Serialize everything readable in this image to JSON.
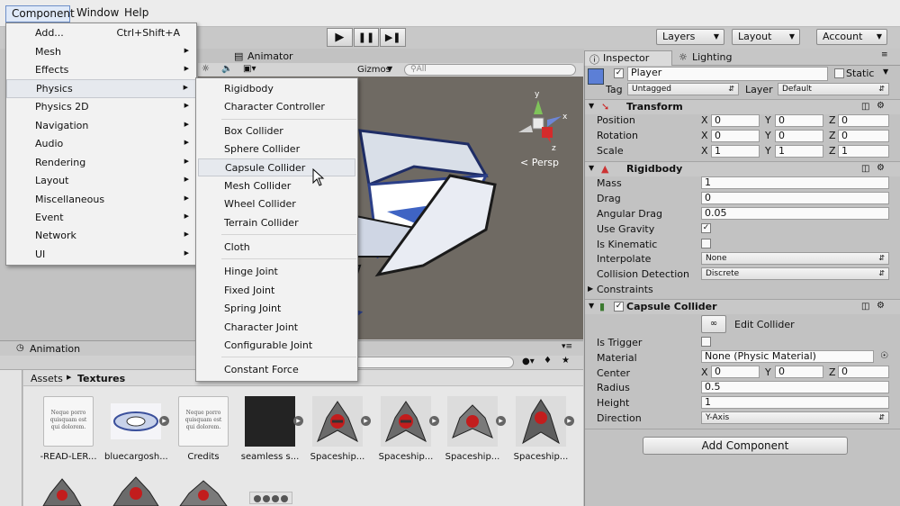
{
  "menubar": {
    "items": [
      {
        "label": "Component"
      },
      {
        "label": "Window"
      },
      {
        "label": "Help"
      }
    ]
  },
  "toolbar": {
    "layers": "Layers",
    "layout": "Layout",
    "account": "Account"
  },
  "scene": {
    "tab_animator": "Animator",
    "gizmos": "Gizmos",
    "search_placeholder": "All",
    "persp_label": "Persp",
    "axis_y": "y",
    "axis_x": "x",
    "axis_z": "z"
  },
  "component_menu": [
    {
      "label": "Add...",
      "shortcut": "Ctrl+Shift+A"
    },
    {
      "label": "Mesh"
    },
    {
      "label": "Effects"
    },
    {
      "label": "Physics"
    },
    {
      "label": "Physics 2D"
    },
    {
      "label": "Navigation"
    },
    {
      "label": "Audio"
    },
    {
      "label": "Rendering"
    },
    {
      "label": "Layout"
    },
    {
      "label": "Miscellaneous"
    },
    {
      "label": "Event"
    },
    {
      "label": "Network"
    },
    {
      "label": "UI"
    }
  ],
  "physics_menu": [
    {
      "label": "Rigidbody"
    },
    {
      "label": "Character Controller"
    },
    {
      "label": "Box Collider"
    },
    {
      "label": "Sphere Collider"
    },
    {
      "label": "Capsule Collider"
    },
    {
      "label": "Mesh Collider"
    },
    {
      "label": "Wheel Collider"
    },
    {
      "label": "Terrain Collider"
    },
    {
      "label": "Cloth"
    },
    {
      "label": "Hinge Joint"
    },
    {
      "label": "Fixed Joint"
    },
    {
      "label": "Spring Joint"
    },
    {
      "label": "Character Joint"
    },
    {
      "label": "Configurable Joint"
    },
    {
      "label": "Constant Force"
    }
  ],
  "animation_tab": "Animation",
  "project": {
    "breadcrumb_root": "Assets",
    "breadcrumb_current": "Textures",
    "doc_preview": "Neque porro quisquam est qui dolorem.",
    "assets": [
      {
        "name": "-READ-LER..."
      },
      {
        "name": "bluecargosh..."
      },
      {
        "name": "Credits"
      },
      {
        "name": "seamless s..."
      },
      {
        "name": "Spaceship..."
      },
      {
        "name": "Spaceship..."
      },
      {
        "name": "Spaceship..."
      },
      {
        "name": "Spaceship..."
      }
    ]
  },
  "inspector": {
    "tab_inspector": "Inspector",
    "tab_lighting": "Lighting",
    "object_name": "Player",
    "static_label": "Static",
    "tag_label": "Tag",
    "tag_value": "Untagged",
    "layer_label": "Layer",
    "layer_value": "Default",
    "transform": {
      "title": "Transform",
      "position_label": "Position",
      "rotation_label": "Rotation",
      "scale_label": "Scale",
      "x": "X",
      "y": "Y",
      "z": "Z",
      "position": [
        "0",
        "0",
        "0"
      ],
      "rotation": [
        "0",
        "0",
        "0"
      ],
      "scale": [
        "1",
        "1",
        "1"
      ]
    },
    "rigidbody": {
      "title": "Rigidbody",
      "mass_label": "Mass",
      "mass": "1",
      "drag_label": "Drag",
      "drag": "0",
      "angular_drag_label": "Angular Drag",
      "angular_drag": "0.05",
      "use_gravity_label": "Use Gravity",
      "use_gravity": true,
      "is_kinematic_label": "Is Kinematic",
      "is_kinematic": false,
      "interpolate_label": "Interpolate",
      "interpolate": "None",
      "collision_detection_label": "Collision Detection",
      "collision_detection": "Discrete",
      "constraints_label": "Constraints"
    },
    "capsule_collider": {
      "title": "Capsule Collider",
      "edit_collider": "Edit Collider",
      "is_trigger_label": "Is Trigger",
      "is_trigger": false,
      "material_label": "Material",
      "material": "None (Physic Material)",
      "center_label": "Center",
      "center": [
        "0",
        "0",
        "0"
      ],
      "radius_label": "Radius",
      "radius": "0.5",
      "height_label": "Height",
      "height": "1",
      "direction_label": "Direction",
      "direction": "Y-Axis"
    },
    "add_component": "Add Component"
  },
  "colors": {
    "menu_highlight": "#e6e9ee",
    "field_bg": "#fafafa",
    "scene_bg": "#6f6a63"
  }
}
